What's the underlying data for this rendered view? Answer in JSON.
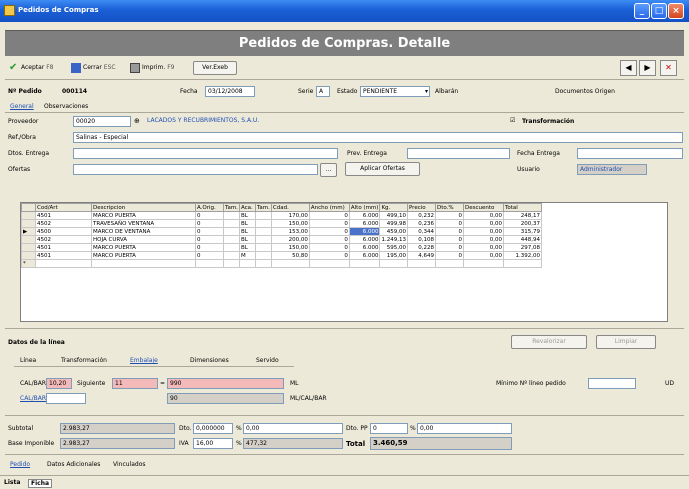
{
  "window": {
    "title": "Pedidos de Compras"
  },
  "banner": {
    "title": "Pedidos de Compras. Detalle"
  },
  "toolbar": {
    "accept": "Aceptar",
    "accept_key": "F8",
    "close": "Cerrar",
    "close_key": "ESC",
    "print": "Imprim.",
    "print_key": "F9",
    "ver_exec": "Ver.Exeb"
  },
  "header": {
    "pedido_label": "Nº Pedido",
    "pedido_value": "000114",
    "fecha_label": "Fecha",
    "fecha_value": "03/12/2008",
    "serie_label": "Serie",
    "serie_value": "A",
    "estado_label": "Estado",
    "estado_value": "PENDIENTE",
    "albaran_label": "Albarán",
    "documentos_label": "Documentos Origen"
  },
  "tabs_top": [
    "General",
    "Observaciones"
  ],
  "general": {
    "proveedor_label": "Proveedor",
    "proveedor_code": "00020",
    "proveedor_name": "LACADOS Y RECUBRIMIENTOS, S.A.U.",
    "transformacion_label": "Transformación",
    "ref_label": "Ref./Obra",
    "ref_value": "Salinas - Especial",
    "dtos_label": "Dtos. Entrega",
    "prev_label": "Prev. Entrega",
    "fecha_entrega_label": "Fecha Entrega",
    "ofertas_label": "Ofertas",
    "aplicar_label": "Aplicar Ofertas",
    "usuario_label": "Usuario",
    "usuario_value": "Administrador"
  },
  "grid": {
    "columns": [
      "Cod/Art",
      "Descripcion",
      "A.Orig.",
      "Tam.",
      "Aca.",
      "Tam.",
      "Cdad.",
      "Ancho (mm)",
      "Alto (mm)",
      "Kg.",
      "Precio",
      "Dto.%",
      "Descuento",
      "Total"
    ],
    "rows": [
      [
        "4501",
        "MARCO PUERTA",
        "0",
        "",
        "BL",
        "",
        "170,00",
        "0",
        "6.000",
        "499,10",
        "0,232",
        "0",
        "0,00",
        "248,17"
      ],
      [
        "4502",
        "TRAVESAÑO VENTANA",
        "0",
        "",
        "BL",
        "",
        "150,00",
        "0",
        "6.000",
        "499,98",
        "0,236",
        "0",
        "0,00",
        "200,37"
      ],
      [
        "4500",
        "MARCO DE VENTANA",
        "0",
        "",
        "BL",
        "",
        "153,00",
        "0",
        "6.000",
        "459,00",
        "0,344",
        "0",
        "0,00",
        "315,79"
      ],
      [
        "4502",
        "HOJA CURVA",
        "0",
        "",
        "BL",
        "",
        "200,00",
        "0",
        "6.000",
        "1.249,13",
        "0,108",
        "0",
        "0,00",
        "448,94"
      ],
      [
        "4501",
        "MARCO PUERTA",
        "0",
        "",
        "BL",
        "",
        "150,00",
        "0",
        "6.000",
        "595,00",
        "0,228",
        "0",
        "0,00",
        "297,08"
      ],
      [
        "4501",
        "MARCO PUERTA",
        "0",
        "",
        "M",
        "",
        "50,80",
        "0",
        "6.000",
        "195,00",
        "4,649",
        "0",
        "0,00",
        "1.392,00"
      ]
    ]
  },
  "linea": {
    "title": "Datos de la línea",
    "btn1": "Revalorizar",
    "btn2": "Limpiar",
    "tabs": [
      "Línea",
      "Transformación",
      "Embalaje",
      "Dimensiones",
      "Servido"
    ],
    "calibar_label": "CAL/BAR",
    "calibar_value": "10,20",
    "siguiente_label": "Siguiente",
    "siguiente_value": "11",
    "eq": "=",
    "val1": "990",
    "unit1": "ML",
    "val2": "90",
    "unit2": "ML/CAL/BAR",
    "calibar2_label": "CAL/BAR",
    "minimo_label": "Mínimo Nº líneo pedido",
    "ud": "UD"
  },
  "totals": {
    "subtotal_label": "Subtotal",
    "subtotal_value": "2.983,27",
    "dto_label": "Dto.",
    "dto_value": "0,000000",
    "dto_pct": "%",
    "dto_amount": "0,00",
    "dto_pp_label": "Dto. PP",
    "dto_pp_value": "0",
    "dto_pp_pct": "%",
    "dto_pp_amount": "0,00",
    "base_label": "Base Imponible",
    "base_value": "2.983,27",
    "iva_label": "IVA",
    "iva_value": "16,00",
    "iva_pct": "%",
    "iva_amount": "477,32",
    "total_label": "Total",
    "total_value": "3.460,59"
  },
  "bottom_tabs": [
    "Pedido",
    "Datos Adicionales",
    "Vinculados"
  ],
  "status_tabs": [
    "Lista",
    "Ficha"
  ]
}
